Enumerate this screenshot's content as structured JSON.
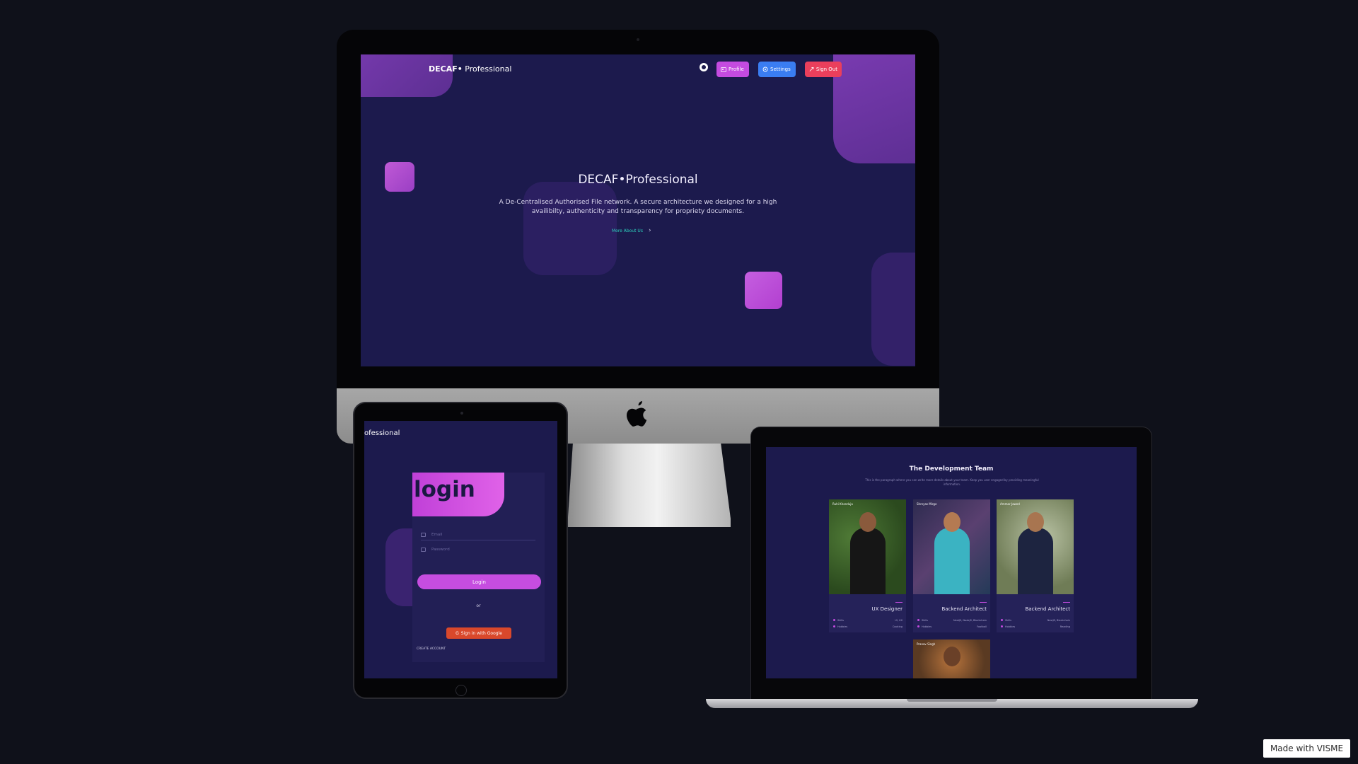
{
  "desktop": {
    "nav": {
      "brand_bold": "DECAF•",
      "brand_light": " Professional",
      "profile_label": "Profile",
      "settings_label": "Settings",
      "signout_label": "Sign Out"
    },
    "hero": {
      "title": "DECAF•Professional",
      "description": "A De-Centralised Authorised File network. A secure architecture we designed for a high availibilty, authenticity and transparency for propriety documents.",
      "link": "More About Us"
    }
  },
  "tablet": {
    "brand": "ofessional",
    "login_title": "login",
    "email_placeholder": "Email",
    "password_placeholder": "Password",
    "login_button": "Login",
    "or_text": "or",
    "google_button": "Sign in with Google",
    "create_account": "CREATE ACCOUNT"
  },
  "laptop": {
    "title": "The Development Team",
    "subtitle": "This is the paragraph where you can write more details about your team. Keep you user engaged by providing meaningful information.",
    "members": [
      {
        "name": "Ruhi Khanduja",
        "role": "UX Designer",
        "skills_label": "Skills",
        "skills": "UI, UX",
        "hobbies_label": "Hobbies",
        "hobbies": "Cooking"
      },
      {
        "name": "Shreyas Mirge",
        "role": "Backend Architect",
        "skills_label": "Skills",
        "skills": "NestJS, NodeJS, Blockchain",
        "hobbies_label": "Hobbies",
        "hobbies": "Football"
      },
      {
        "name": "Ammar Jawed",
        "role": "Backend Architect",
        "skills_label": "Skills",
        "skills": "NestJS, Blockchain",
        "hobbies_label": "Hobbies",
        "hobbies": "Reading"
      },
      {
        "name": "Pranav Singh"
      }
    ]
  },
  "badge": "Made with VISME",
  "colors": {
    "background": "#0f111a",
    "screen": "#1c1a4d",
    "accent_purple": "#c44be0",
    "accent_blue": "#3a7df2",
    "accent_red": "#ea3f5c",
    "link_teal": "#2dd4bf",
    "google_red": "#d9482b"
  }
}
